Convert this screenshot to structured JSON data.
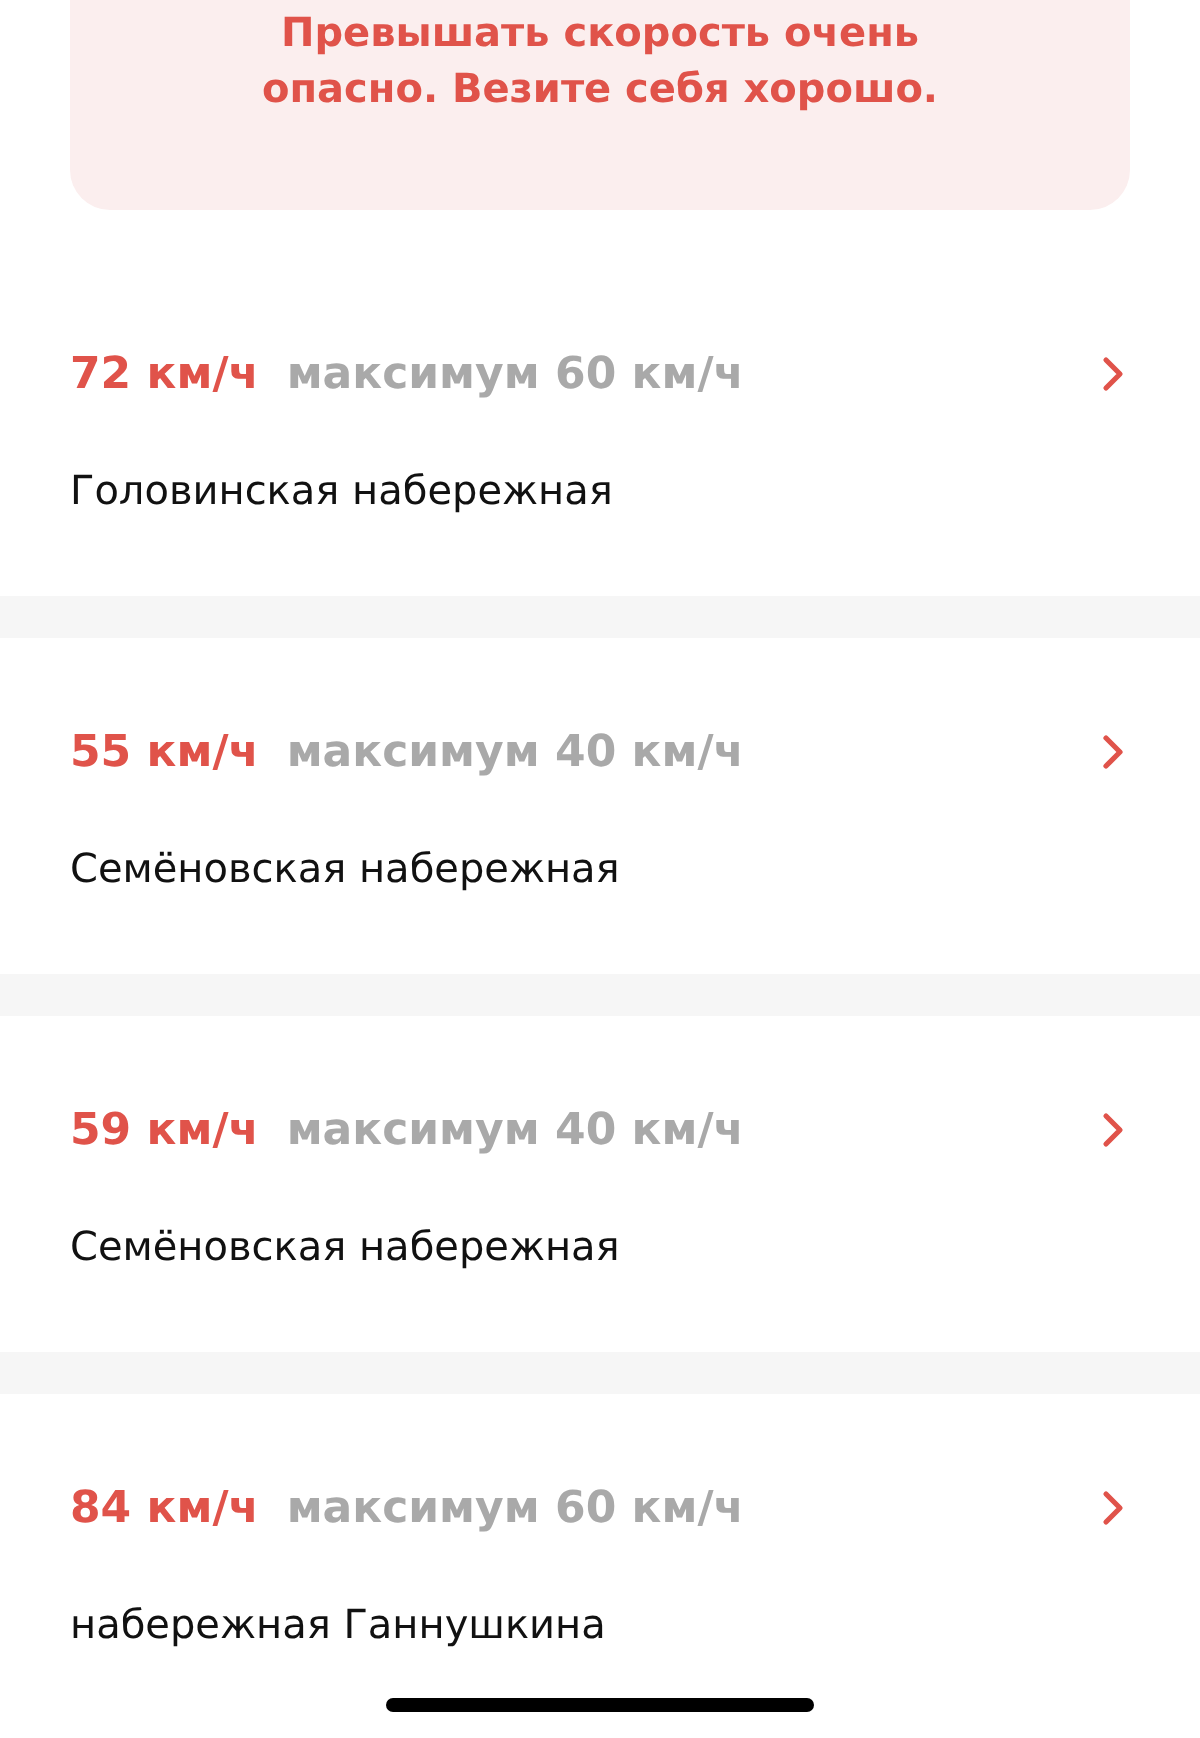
{
  "warning": {
    "text": "Превышать скорость очень опасно. Везите себя хорошо."
  },
  "violations": [
    {
      "speed": "72 км/ч",
      "limit": "максимум 60 км/ч",
      "street": "Головинская набережная"
    },
    {
      "speed": "55 км/ч",
      "limit": "максимум 40 км/ч",
      "street": "Семёновская набережная"
    },
    {
      "speed": "59 км/ч",
      "limit": "максимум 40 км/ч",
      "street": "Семёновская набережная"
    },
    {
      "speed": "84 км/ч",
      "limit": "максимум 60 км/ч",
      "street": "набережная Ганнушкина"
    }
  ]
}
